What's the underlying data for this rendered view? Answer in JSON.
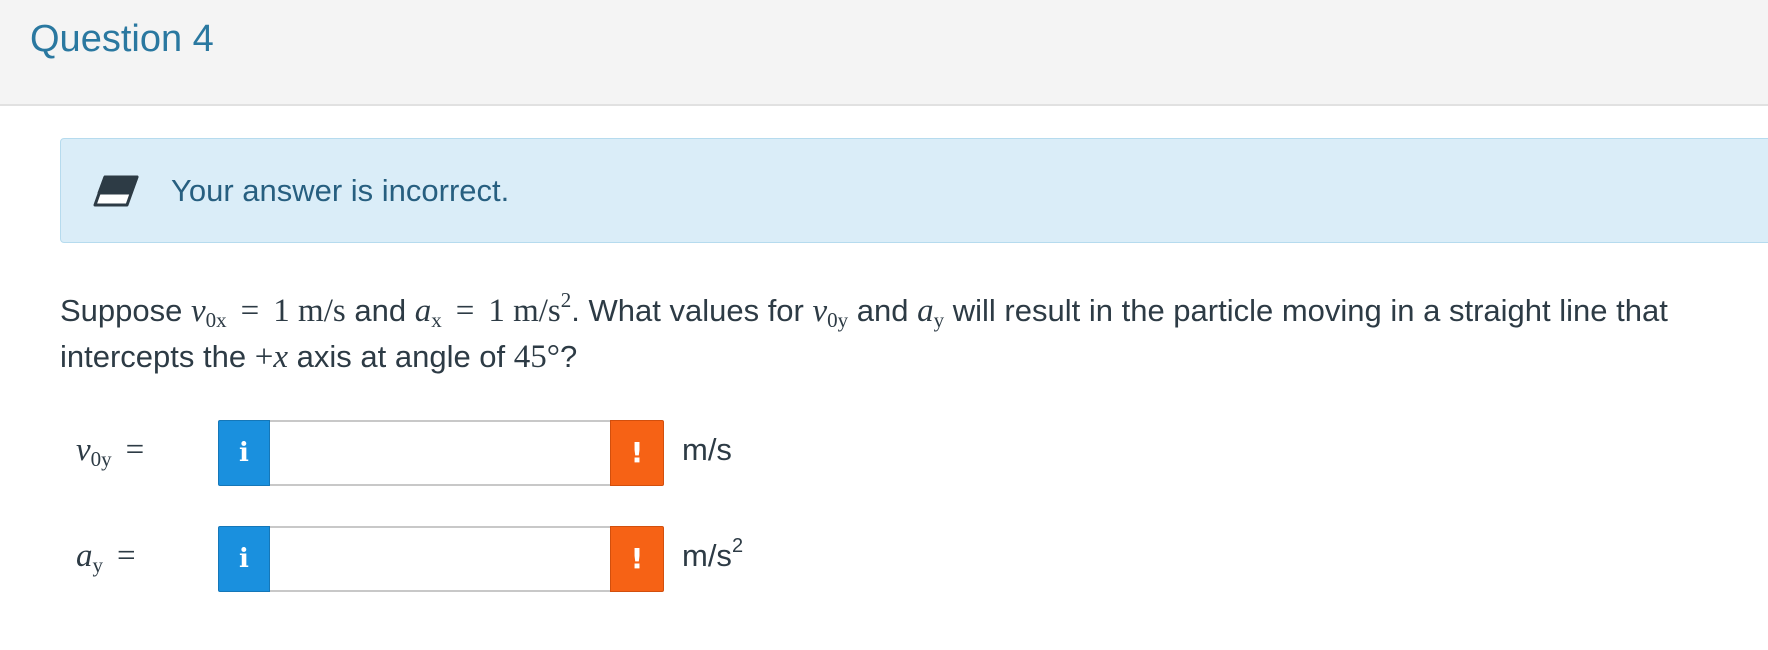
{
  "header": {
    "title": "Question 4"
  },
  "feedback": {
    "icon": "eraser-icon",
    "message": "Your answer is incorrect.",
    "background": "#daedf8",
    "text_color": "#275f80"
  },
  "question": {
    "suppose": "Suppose",
    "v0x_symbol": "v",
    "v0x_sub": "0x",
    "eq1": "=",
    "v0x_value": "1 m/s",
    "and1": "and",
    "ax_symbol": "a",
    "ax_sub": "x",
    "eq2": "=",
    "ax_value": "1 m/s",
    "ax_exp": "2",
    "what": ". What values for",
    "v0y_symbol": "v",
    "v0y_sub": "0y",
    "and2": "and",
    "ay_symbol": "a",
    "ay_sub": "y",
    "rest1": "will result in the particle moving in a straight line that intercepts the",
    "plus": "+",
    "x_symbol": "x",
    "rest2": "axis at angle of",
    "angle": "45°",
    "qmark": "?"
  },
  "answers": [
    {
      "symbol": "v",
      "sub": "0y",
      "equals": "=",
      "info_label": "i",
      "value": "",
      "placeholder": "",
      "warn_label": "!",
      "unit": "m/s",
      "unit_exp": ""
    },
    {
      "symbol": "a",
      "sub": "y",
      "equals": "=",
      "info_label": "i",
      "value": "",
      "placeholder": "",
      "warn_label": "!",
      "unit": "m/s",
      "unit_exp": "2"
    }
  ],
  "colors": {
    "title": "#2a78a0",
    "info_button": "#1a90de",
    "warn_button": "#f66215"
  }
}
